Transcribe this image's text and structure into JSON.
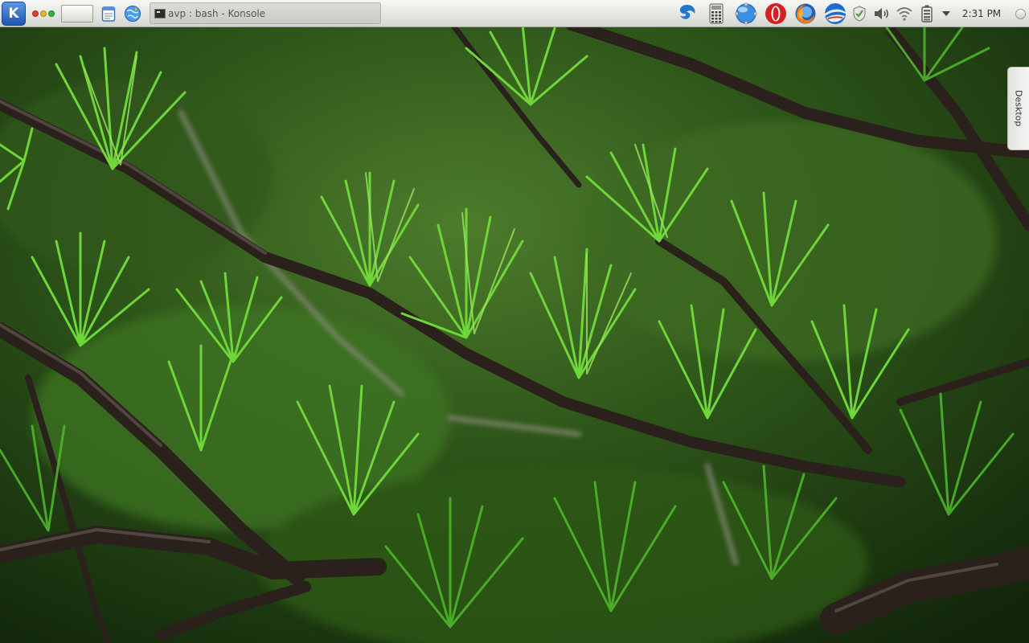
{
  "panel": {
    "taskbar_entry_title": "avp : bash - Konsole",
    "clock": "2:31 PM"
  },
  "desktop_tab": {
    "label": "Desktop"
  },
  "launchers": [
    {
      "icon": "kde-menu-icon"
    },
    {
      "icon": "window-dots-icon"
    },
    {
      "icon": "pager-icon"
    },
    {
      "icon": "notes-icon"
    },
    {
      "icon": "browser-globe-icon"
    }
  ],
  "tray_icons": [
    "swirl-app-icon",
    "calculator-icon",
    "network-globe-icon",
    "opera-icon",
    "firefox-icon",
    "weather-icon",
    "shield-icon",
    "volume-icon",
    "wifi-icon",
    "battery-icon",
    "tray-expand-arrow-icon"
  ],
  "colors": {
    "panel_top": "#f7f7f5",
    "panel_bottom": "#d3d5cf",
    "accent_blue": "#1d56b2",
    "dot_red": "#e23b32",
    "dot_yellow": "#e8b82a",
    "dot_green": "#3ab03c"
  }
}
